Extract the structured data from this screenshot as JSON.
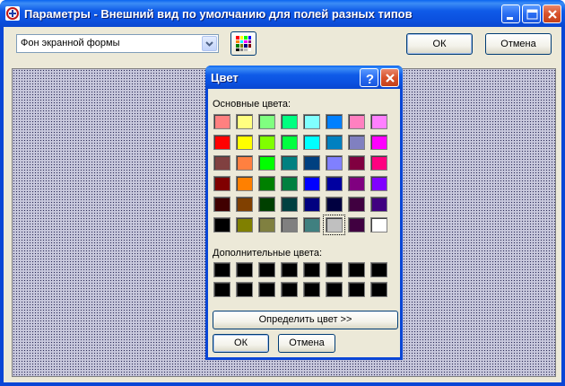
{
  "window": {
    "title": "Параметры - Внешний вид по умолчанию для полей разных типов"
  },
  "toolbar": {
    "dropdown_value": "Фон экранной формы",
    "ok_label": "ОК",
    "cancel_label": "Отмена"
  },
  "color_dialog": {
    "title": "Цвет",
    "basic_colors_label": "Основные цвета:",
    "custom_colors_label": "Дополнительные цвета:",
    "define_label": "Определить цвет >>",
    "ok_label": "ОК",
    "cancel_label": "Отмена",
    "selected_color": "#c0c0c0",
    "basic_colors": [
      [
        "#ff8080",
        "#ffff80",
        "#80ff80",
        "#00ff80",
        "#80ffff",
        "#0080ff",
        "#ff80c0",
        "#ff80ff"
      ],
      [
        "#ff0000",
        "#ffff00",
        "#80ff00",
        "#00ff40",
        "#00ffff",
        "#0080c0",
        "#8080c0",
        "#ff00ff"
      ],
      [
        "#804040",
        "#ff8040",
        "#00ff00",
        "#008080",
        "#004080",
        "#8080ff",
        "#800040",
        "#ff0080"
      ],
      [
        "#800000",
        "#ff8000",
        "#008000",
        "#008040",
        "#0000ff",
        "#0000a0",
        "#800080",
        "#8000ff"
      ],
      [
        "#400000",
        "#804000",
        "#004000",
        "#004040",
        "#000080",
        "#000040",
        "#400040",
        "#400080"
      ],
      [
        "#000000",
        "#808000",
        "#808040",
        "#808080",
        "#408080",
        "#c0c0c0",
        "#400040",
        "#ffffff"
      ]
    ],
    "custom_colors": [
      [
        "#000000",
        "#000000",
        "#000000",
        "#000000",
        "#000000",
        "#000000",
        "#000000",
        "#000000"
      ],
      [
        "#000000",
        "#000000",
        "#000000",
        "#000000",
        "#000000",
        "#000000",
        "#000000",
        "#000000"
      ]
    ]
  }
}
